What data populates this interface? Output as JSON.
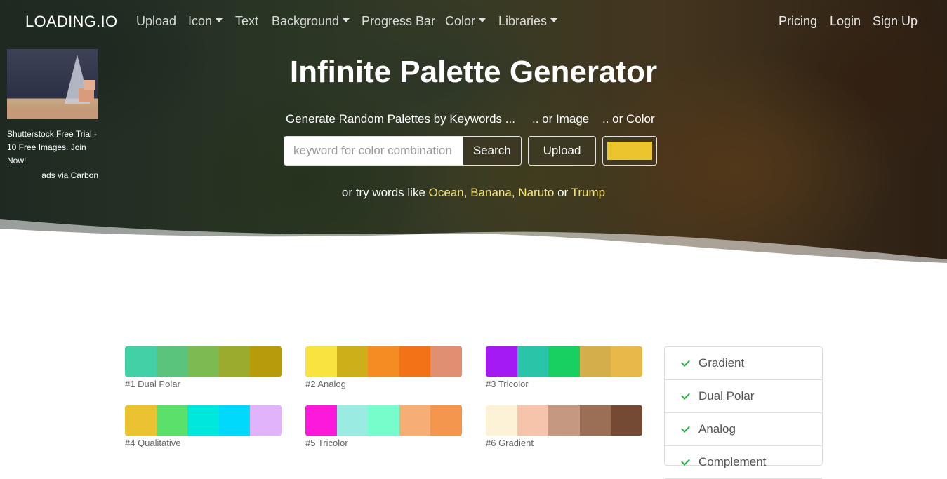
{
  "nav": {
    "brand": "LOADING.IO",
    "items": [
      {
        "label": "Upload",
        "dropdown": false
      },
      {
        "label": "Icon",
        "dropdown": true
      },
      {
        "label": "Text",
        "dropdown": false
      },
      {
        "label": "Background",
        "dropdown": true
      },
      {
        "label": "Progress Bar",
        "dropdown": false
      },
      {
        "label": "Color",
        "dropdown": true
      },
      {
        "label": "Libraries",
        "dropdown": true
      }
    ],
    "right": [
      "Pricing",
      "Login",
      "Sign Up"
    ]
  },
  "ad": {
    "text": "Shutterstock Free Trial - 10 Free Images. Join Now!",
    "via": "ads via Carbon"
  },
  "hero": {
    "title": "Infinite Palette Generator",
    "by_keywords": "Generate Random Palettes by Keywords ...",
    "or_image": ".. or Image",
    "or_color": ".. or Color",
    "search_placeholder": "keyword for color combination",
    "search_label": "Search",
    "upload_label": "Upload",
    "picked_color": "#ecc42e",
    "try_prefix": "or try words like",
    "try_words": [
      "Ocean",
      "Banana",
      "Naruto",
      "Trump"
    ],
    "try_or": "or"
  },
  "palettes": [
    {
      "label": "#1 Dual Polar",
      "colors": [
        "#42d1a6",
        "#5ac47c",
        "#7cbb52",
        "#9aab2e",
        "#b89b0a"
      ]
    },
    {
      "label": "#2 Analog",
      "colors": [
        "#f9e43f",
        "#cdb019",
        "#f48c23",
        "#f37217",
        "#e08f72"
      ]
    },
    {
      "label": "#3 Tricolor",
      "colors": [
        "#a41af2",
        "#2ac5a8",
        "#18cf62",
        "#d4ae4a",
        "#e8b94a"
      ]
    },
    {
      "label": "#4 Qualitative",
      "colors": [
        "#ebc22f",
        "#5ae06b",
        "#00e8de",
        "#00d9fb",
        "#e1b3fa"
      ]
    },
    {
      "label": "#5 Tricolor",
      "colors": [
        "#fc19da",
        "#9aebe1",
        "#76fdcb",
        "#f6ae74",
        "#f4964d"
      ]
    },
    {
      "label": "#6 Gradient",
      "colors": [
        "#fdf1d6",
        "#f6c4aa",
        "#c59882",
        "#9b6f55",
        "#754a34"
      ]
    }
  ],
  "filters": [
    "Gradient",
    "Dual Polar",
    "Analog",
    "Complement"
  ]
}
